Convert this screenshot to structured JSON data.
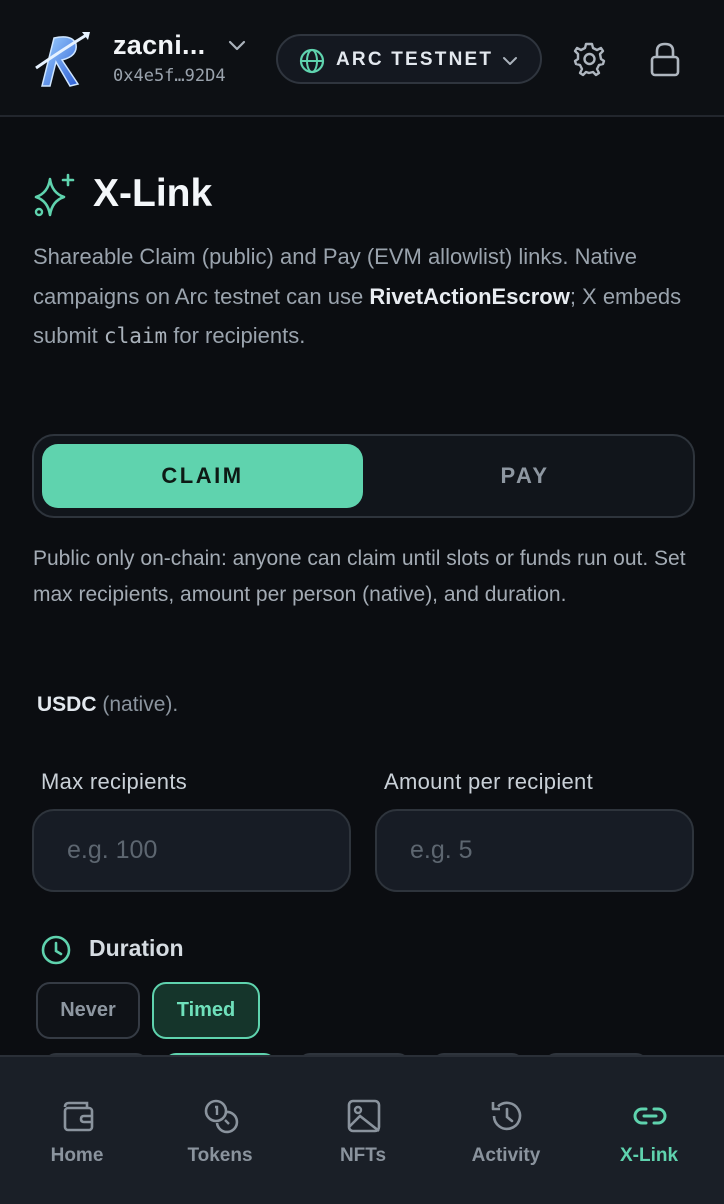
{
  "header": {
    "account_name": "zacni...",
    "account_address": "0x4e5f…92D4",
    "network": "ARC TESTNET"
  },
  "main": {
    "title": "X-Link",
    "description": {
      "line1": "Shareable Claim (public) and Pay (EVM allowlist) links. Native campaigns on Arc testnet can use ",
      "contract": "RivetActionEscrow",
      "line2": "; X embeds submit ",
      "code": "claim",
      "line3": " for recipients."
    },
    "modes": {
      "claim": "CLAIM",
      "pay": "PAY",
      "selected": "CLAIM"
    },
    "info": "Public only on-chain: anyone can claim until slots or funds run out. Set max recipients, amount per person (native), and duration.",
    "token": {
      "symbol": "USDC",
      "suffix": " (native)."
    },
    "fields": {
      "max_label": "Max recipients",
      "max_placeholder": "e.g. 100",
      "max_value": "",
      "amount_label": "Amount per recipient",
      "amount_placeholder": "e.g. 5",
      "amount_value": ""
    },
    "duration": {
      "label": "Duration",
      "options": [
        "Never",
        "Timed"
      ],
      "selected": "Timed"
    }
  },
  "nav": {
    "items": [
      {
        "label": "Home",
        "icon": "wallet-icon"
      },
      {
        "label": "Tokens",
        "icon": "coins-icon"
      },
      {
        "label": "NFTs",
        "icon": "image-icon"
      },
      {
        "label": "Activity",
        "icon": "history-icon"
      },
      {
        "label": "X-Link",
        "icon": "link-icon"
      }
    ],
    "active": "X-Link"
  },
  "colors": {
    "accent": "#5fd3ae",
    "background": "#0b0d11",
    "nav_background": "#1a1f27"
  }
}
